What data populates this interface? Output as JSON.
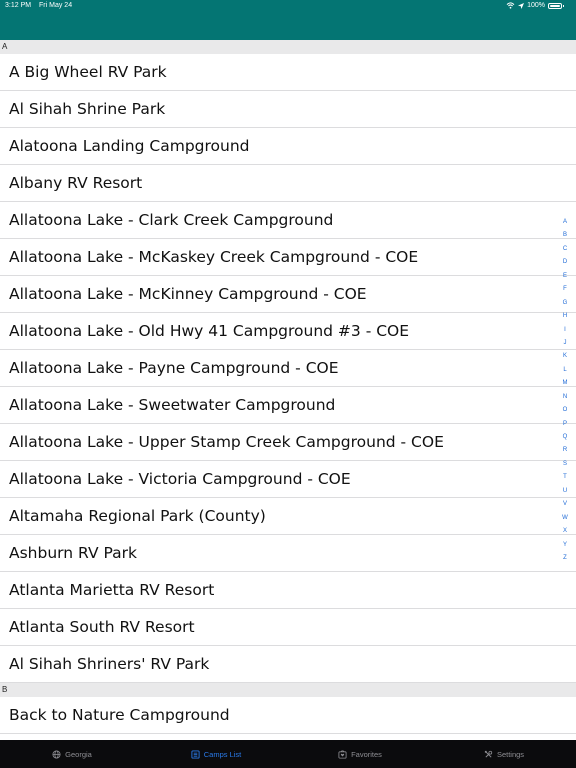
{
  "status": {
    "time": "3:12 PM",
    "date": "Fri May 24",
    "battery": "100%",
    "battery_level": 1.0
  },
  "list": {
    "sections": [
      {
        "header": "A",
        "rows": [
          "A Big Wheel RV Park",
          "Al Sihah Shrine Park",
          "Alatoona Landing Campground",
          "Albany RV Resort",
          "Allatoona Lake - Clark Creek Campground",
          "Allatoona Lake - McKaskey Creek Campground - COE",
          "Allatoona Lake - McKinney Campground - COE",
          "Allatoona Lake - Old Hwy 41 Campground #3 - COE",
          "Allatoona Lake - Payne Campground - COE",
          "Allatoona Lake - Sweetwater Campground",
          "Allatoona Lake - Upper Stamp Creek Campground - COE",
          "Allatoona Lake - Victoria Campground - COE",
          "Altamaha Regional Park (County)",
          "Ashburn RV Park",
          "Atlanta Marietta RV Resort",
          "Atlanta South RV Resort",
          "Al Sihah Shriners' RV Park"
        ]
      },
      {
        "header": "B",
        "rows": [
          "Back to Nature Campground"
        ]
      }
    ]
  },
  "index_letters": [
    "A",
    "B",
    "C",
    "D",
    "E",
    "F",
    "G",
    "H",
    "I",
    "J",
    "K",
    "L",
    "M",
    "N",
    "O",
    "P",
    "Q",
    "R",
    "S",
    "T",
    "U",
    "V",
    "W",
    "X",
    "Y",
    "Z"
  ],
  "tabs": [
    {
      "label": "Georgia",
      "icon": "globe-icon",
      "active": false
    },
    {
      "label": "Camps List",
      "icon": "list-icon",
      "active": true
    },
    {
      "label": "Favorites",
      "icon": "favorites-icon",
      "active": false
    },
    {
      "label": "Settings",
      "icon": "settings-icon",
      "active": false
    }
  ],
  "colors": {
    "header_bar": "#047573",
    "tab_active": "#2a7bea",
    "index": "#1e6ad6"
  }
}
